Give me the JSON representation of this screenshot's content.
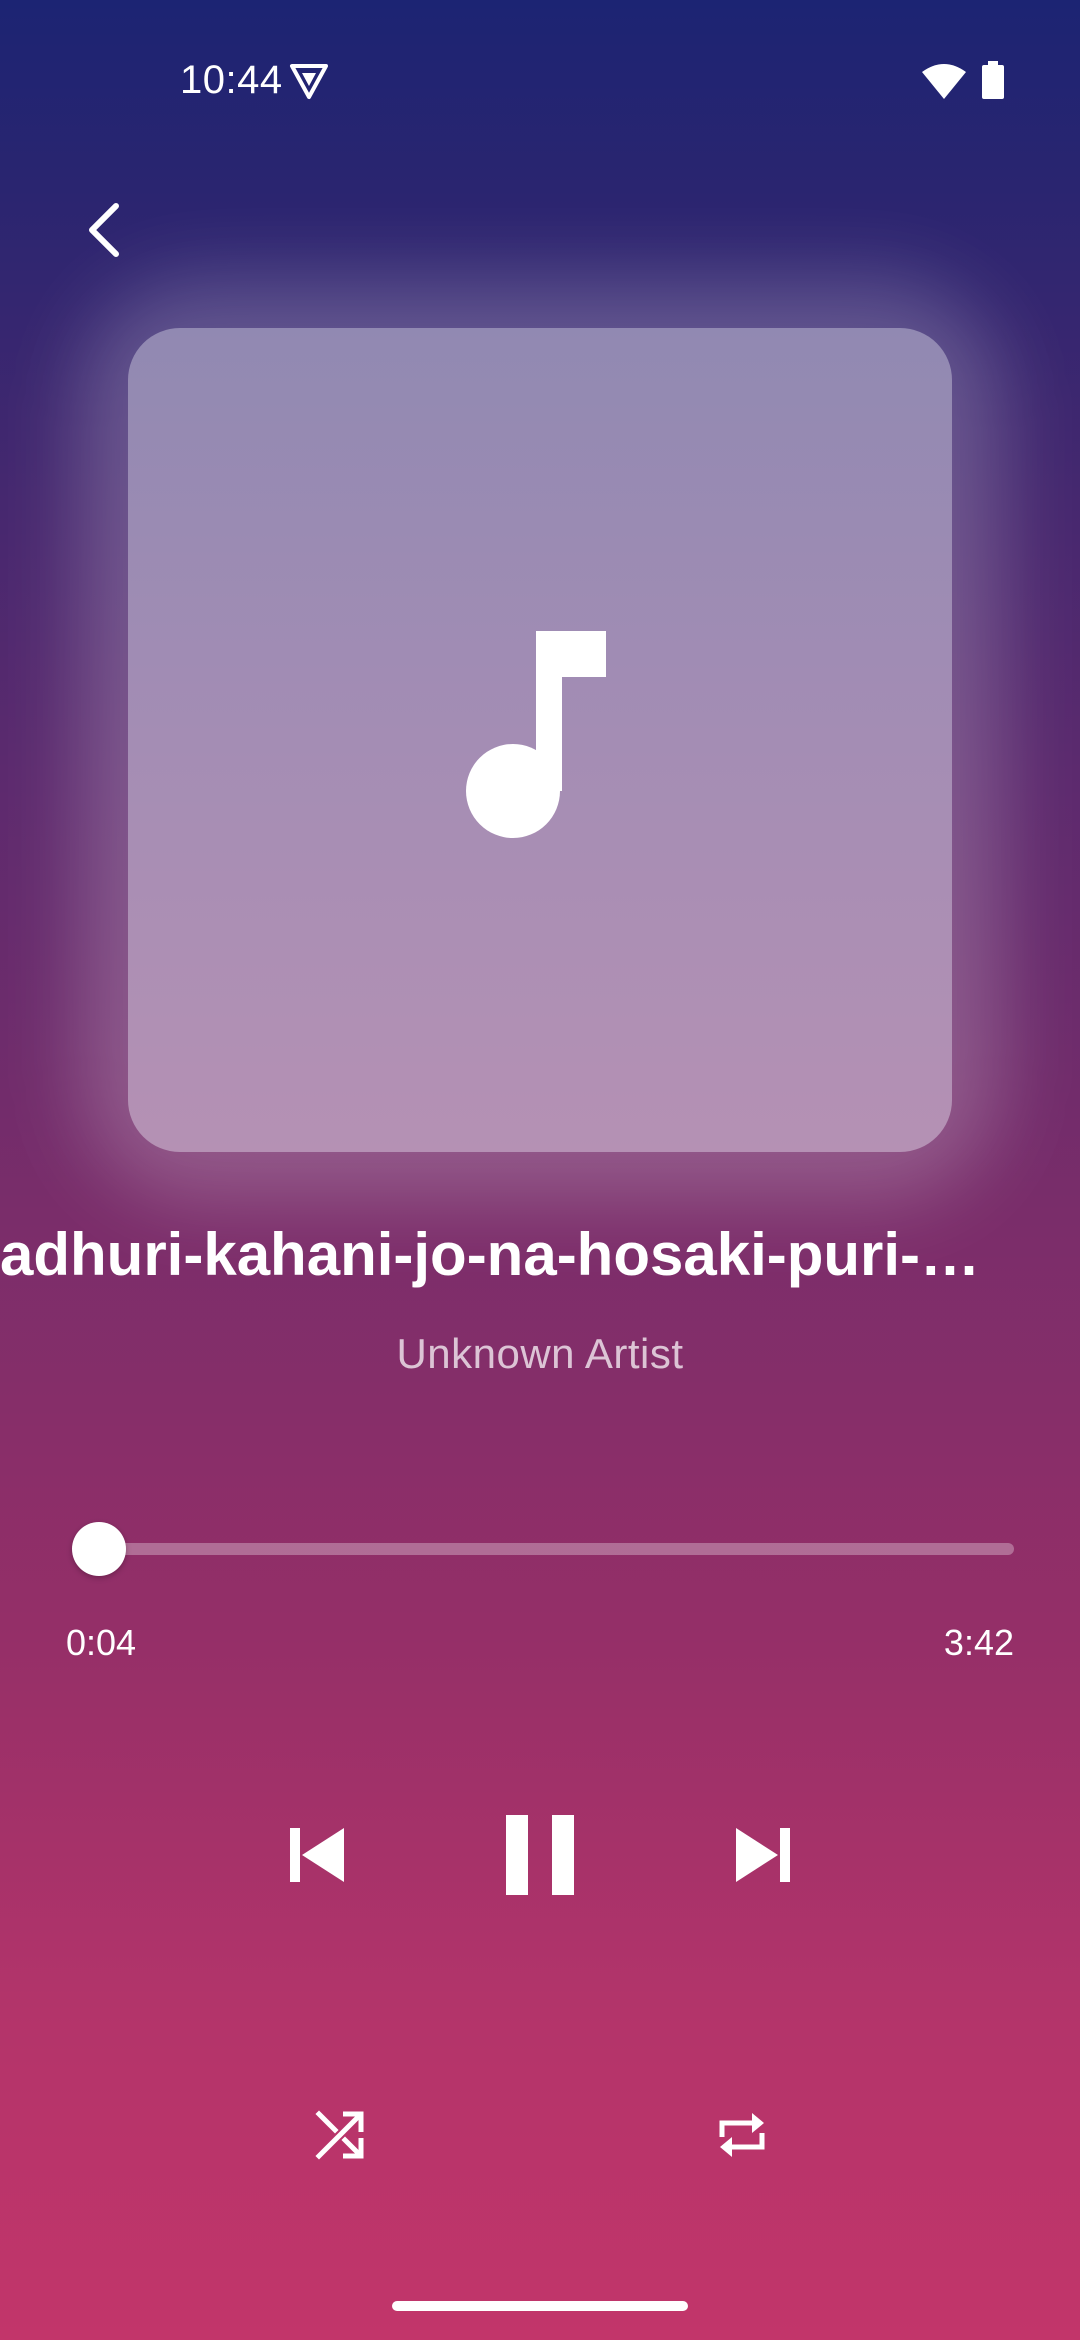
{
  "status_bar": {
    "time": "10:44",
    "vpn_icon": "vpn-shield-icon",
    "wifi_icon": "wifi-icon",
    "battery_icon": "battery-icon"
  },
  "header": {
    "back_icon": "chevron-left-icon"
  },
  "album_art": {
    "icon": "music-note-icon"
  },
  "track": {
    "title": "adhuri-kahani-jo-na-hosaki-puri-…",
    "artist": "Unknown Artist"
  },
  "progress": {
    "elapsed": "0:04",
    "total": "3:42",
    "fraction": 0.018
  },
  "controls": {
    "previous_icon": "skip-previous-icon",
    "play_pause_icon": "pause-icon",
    "next_icon": "skip-next-icon",
    "shuffle_icon": "shuffle-icon",
    "repeat_icon": "repeat-icon"
  },
  "colors": {
    "gradient_top": "#1c2473",
    "gradient_bottom": "#c2356a",
    "foreground": "#ffffff"
  }
}
